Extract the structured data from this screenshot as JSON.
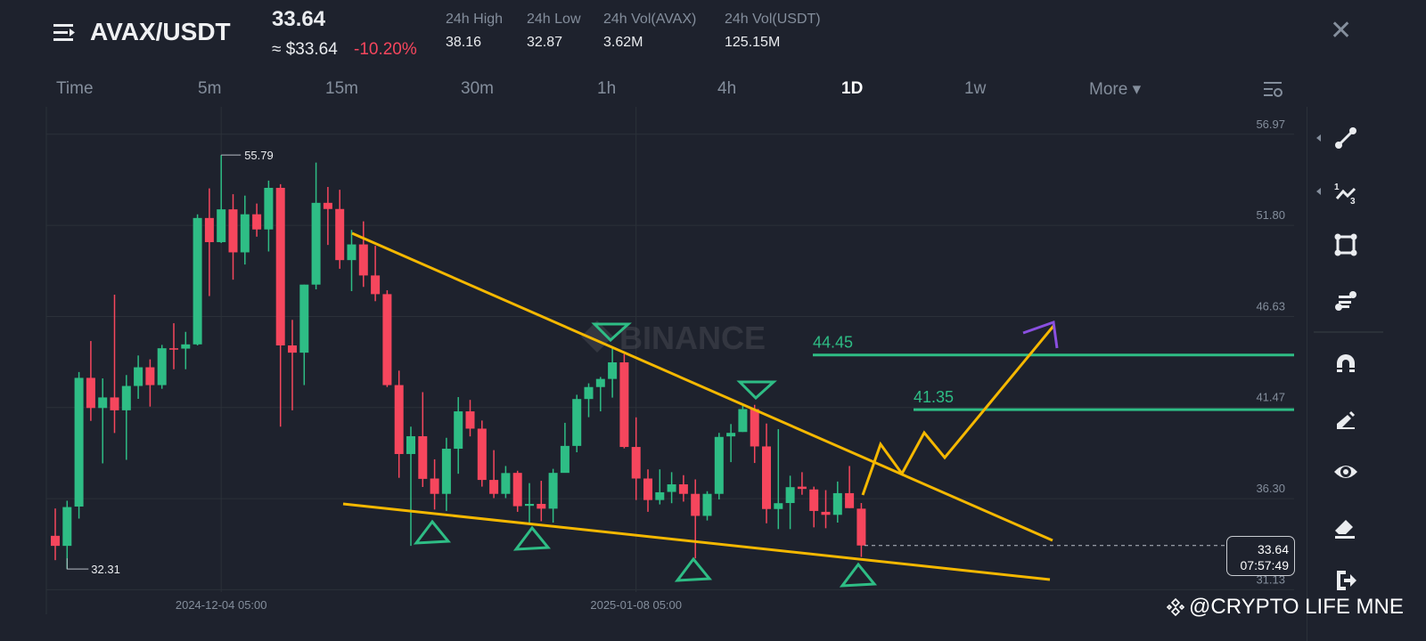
{
  "header": {
    "pair": "AVAX/USDT",
    "last_price": "33.64",
    "approx_usd": "≈ $33.64",
    "change_pct": "-10.20%",
    "stats": [
      {
        "label": "24h High",
        "value": "38.16"
      },
      {
        "label": "24h Low",
        "value": "32.87"
      },
      {
        "label": "24h Vol(AVAX)",
        "value": "3.62M"
      },
      {
        "label": "24h Vol(USDT)",
        "value": "125.15M"
      }
    ],
    "close_label": "✕"
  },
  "timeframes": [
    {
      "label": "Time"
    },
    {
      "label": "5m"
    },
    {
      "label": "15m"
    },
    {
      "label": "30m"
    },
    {
      "label": "1h"
    },
    {
      "label": "4h"
    },
    {
      "label": "1D",
      "active": true
    },
    {
      "label": "1w"
    },
    {
      "label": "More ▾"
    }
  ],
  "price_box": {
    "price": "33.64",
    "countdown": "07:57:49"
  },
  "watermark": "BINANCE",
  "credit": "@CRYPTO LIFE MNE",
  "colors": {
    "up": "#2ebd85",
    "down": "#f6465d",
    "trend": "#f5b800",
    "projection_head": "#8a4fe0",
    "grid": "#2b3139"
  },
  "chart_data": {
    "type": "candlestick",
    "interval": "1D",
    "y_ticks": [
      56.97,
      51.8,
      46.63,
      41.47,
      36.3,
      31.13
    ],
    "ylim": [
      31.13,
      56.97
    ],
    "x_labels": [
      {
        "index": 14,
        "text": "2024-12-04 05:00"
      },
      {
        "index": 49,
        "text": "2025-01-08 05:00"
      }
    ],
    "high_marker": {
      "index": 14,
      "text": "55.79",
      "value": 55.79
    },
    "low_marker": {
      "index": 1,
      "text": "32.31",
      "value": 32.31
    },
    "levels": [
      {
        "value": 44.45,
        "text": "44.45"
      },
      {
        "value": 41.35,
        "text": "41.35"
      }
    ],
    "current_price": 33.64,
    "ohlc": [
      [
        34.19,
        35.74,
        32.81,
        33.62
      ],
      [
        33.62,
        36.18,
        32.31,
        35.82
      ],
      [
        35.85,
        43.48,
        35.17,
        43.15
      ],
      [
        43.15,
        45.24,
        40.71,
        41.44
      ],
      [
        41.44,
        43.12,
        38.3,
        42.04
      ],
      [
        42.04,
        47.87,
        40.02,
        41.31
      ],
      [
        41.31,
        43.31,
        38.5,
        42.69
      ],
      [
        42.69,
        44.42,
        41.96,
        43.75
      ],
      [
        43.75,
        44.2,
        41.52,
        42.74
      ],
      [
        42.74,
        45.02,
        42.53,
        44.83
      ],
      [
        44.83,
        46.25,
        43.64,
        44.75
      ],
      [
        44.81,
        45.76,
        43.64,
        45.05
      ],
      [
        45.05,
        52.43,
        44.99,
        52.22
      ],
      [
        52.22,
        53.9,
        47.79,
        50.85
      ],
      [
        50.85,
        55.79,
        50.8,
        52.71
      ],
      [
        52.71,
        53.57,
        48.72,
        50.27
      ],
      [
        50.27,
        53.49,
        49.58,
        52.43
      ],
      [
        52.43,
        53.04,
        51.16,
        51.57
      ],
      [
        51.57,
        54.34,
        50.32,
        53.93
      ],
      [
        53.93,
        54.14,
        40.38,
        44.99
      ],
      [
        44.99,
        46.44,
        41.31,
        44.58
      ],
      [
        44.58,
        48.44,
        42.74,
        48.44
      ],
      [
        48.44,
        55.36,
        48.17,
        53.08
      ],
      [
        53.08,
        53.98,
        50.69,
        52.73
      ],
      [
        52.73,
        53.82,
        49.34,
        49.83
      ],
      [
        49.83,
        51.54,
        48.07,
        50.72
      ],
      [
        50.72,
        52.03,
        48.31,
        48.96
      ],
      [
        48.96,
        50.64,
        47.5,
        47.9
      ],
      [
        47.9,
        48.12,
        42.63,
        42.74
      ],
      [
        42.74,
        43.56,
        37.48,
        38.83
      ],
      [
        38.83,
        40.38,
        33.62,
        39.84
      ],
      [
        39.84,
        42.34,
        36.96,
        37.42
      ],
      [
        37.44,
        38.53,
        35.68,
        36.57
      ],
      [
        36.57,
        39.75,
        35.6,
        39.13
      ],
      [
        39.13,
        42.06,
        37.71,
        41.25
      ],
      [
        41.25,
        41.9,
        39.83,
        40.27
      ],
      [
        40.27,
        40.73,
        36.98,
        37.36
      ],
      [
        37.36,
        39.05,
        36.33,
        36.57
      ],
      [
        36.57,
        38.15,
        36.33,
        37.75
      ],
      [
        37.76,
        37.88,
        35.55,
        35.87
      ],
      [
        35.89,
        37.18,
        34.94,
        36.0
      ],
      [
        36.0,
        37.31,
        35.02,
        35.73
      ],
      [
        35.73,
        37.99,
        34.94,
        37.76
      ],
      [
        37.76,
        40.6,
        37.8,
        39.29
      ],
      [
        39.29,
        42.19,
        38.93,
        41.95
      ],
      [
        41.95,
        42.84,
        40.92,
        42.63
      ],
      [
        42.63,
        43.2,
        41.25,
        43.09
      ],
      [
        43.09,
        44.83,
        42.03,
        44.03
      ],
      [
        44.03,
        44.5,
        39.15,
        39.23
      ],
      [
        39.23,
        40.91,
        36.22,
        37.44
      ],
      [
        37.44,
        37.96,
        35.55,
        36.22
      ],
      [
        36.22,
        37.96,
        35.97,
        36.66
      ],
      [
        36.68,
        37.8,
        36.04,
        37.11
      ],
      [
        37.11,
        37.63,
        36.13,
        36.57
      ],
      [
        36.57,
        37.39,
        32.91,
        35.32
      ],
      [
        35.32,
        36.72,
        35.06,
        36.57
      ],
      [
        36.57,
        40.03,
        36.25,
        39.8
      ],
      [
        39.83,
        40.53,
        38.37,
        40.03
      ],
      [
        40.08,
        41.57,
        40.08,
        41.38
      ],
      [
        41.38,
        41.62,
        38.32,
        39.26
      ],
      [
        39.26,
        40.56,
        34.9,
        35.71
      ],
      [
        35.71,
        40.24,
        34.57,
        36.04
      ],
      [
        36.05,
        37.6,
        34.57,
        36.95
      ],
      [
        36.98,
        37.8,
        36.52,
        36.85
      ],
      [
        36.82,
        36.98,
        34.67,
        35.6
      ],
      [
        35.55,
        36.78,
        34.62,
        35.38
      ],
      [
        35.38,
        37.27,
        34.94,
        36.61
      ],
      [
        36.61,
        38.15,
        35.76,
        35.76
      ],
      [
        35.73,
        36.05,
        32.99,
        33.64
      ]
    ]
  }
}
